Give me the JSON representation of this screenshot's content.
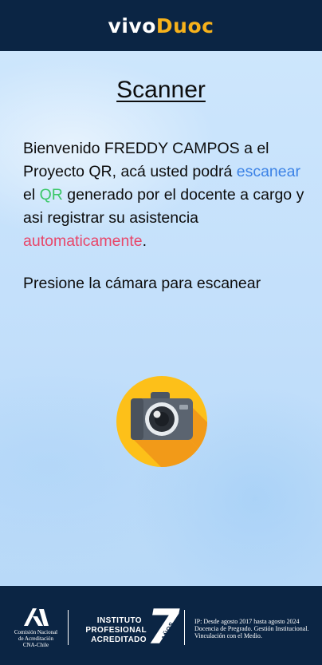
{
  "header": {
    "logo_part1": "vivo",
    "logo_part2": "Duoc"
  },
  "main": {
    "title": "Scanner",
    "intro": {
      "t1": "Bienvenido FREDDY CAMPOS a el Proyecto QR, acá usted podrá ",
      "w_scan": "escanear",
      "t2": " el ",
      "w_qr": "QR",
      "t3": " generado por el docente a cargo y asi registrar su asistencia ",
      "w_auto": "automaticamente",
      "t4": "."
    },
    "instruction": "Presione la cámara para escanear",
    "camera_button_icon": "camera-icon"
  },
  "footer": {
    "cna_text": "Comisión Nacional\nde Acreditación\nCNA-Chile",
    "institute_line1": "INSTITUTO",
    "institute_line2": "PROFESIONAL",
    "institute_line3": "ACREDITADO",
    "years_number": "7",
    "years_word": "AÑOS",
    "accreditation_text": "IP: Desde agosto 2017 hasta agosto 2024 Docencia de Pregrado. Gestión Institucional. Vinculación con el Medio."
  },
  "colors": {
    "header_bg": "#0b2544",
    "logo_accent": "#f7b21b",
    "link_blue": "#3b82e6",
    "qr_green": "#3cc86a",
    "auto_red": "#e8476a",
    "camera_circle": "#fdc019"
  }
}
